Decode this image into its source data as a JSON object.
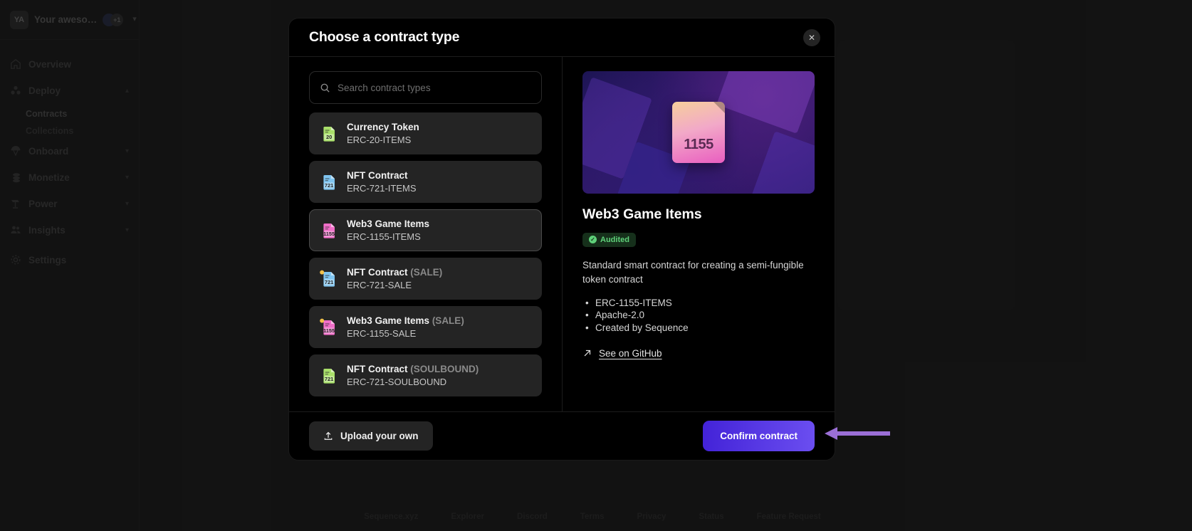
{
  "sidebar": {
    "org": {
      "avatar_initials": "YA",
      "name": "Your aweso…",
      "extra_count": "+1",
      "chevron": "chevron-down"
    },
    "items": [
      {
        "label": "Overview",
        "icon": "home-icon",
        "has_caret": false
      },
      {
        "label": "Deploy",
        "icon": "deploy-icon",
        "has_caret": true,
        "caret": "chevron-up"
      },
      {
        "label": "Onboard",
        "icon": "parachute-icon",
        "has_caret": true,
        "caret": "chevron-down"
      },
      {
        "label": "Monetize",
        "icon": "coins-icon",
        "has_caret": true,
        "caret": "chevron-down"
      },
      {
        "label": "Power",
        "icon": "power-icon",
        "has_caret": true,
        "caret": "chevron-down"
      },
      {
        "label": "Insights",
        "icon": "people-icon",
        "has_caret": true,
        "caret": "chevron-down"
      },
      {
        "label": "Settings",
        "icon": "gear-icon",
        "has_caret": false
      }
    ],
    "deploy_subitems": [
      {
        "label": "Contracts",
        "active": true
      },
      {
        "label": "Collections",
        "active": false
      }
    ]
  },
  "page_footer": {
    "links": [
      "Sequence.xyz",
      "Explorer",
      "Discord",
      "Terms",
      "Privacy",
      "Status",
      "Feature Request"
    ]
  },
  "modal": {
    "title": "Choose a contract type",
    "close_label": "✕",
    "search": {
      "placeholder": "Search contract types",
      "value": ""
    },
    "contract_types": [
      {
        "name": "Currency Token",
        "variant": "",
        "code": "ERC-20-ITEMS",
        "icon": "erc20-file-icon",
        "badge": "20",
        "color": "#a9e06a",
        "selected": false,
        "sale": false
      },
      {
        "name": "NFT Contract",
        "variant": "",
        "code": "ERC-721-ITEMS",
        "icon": "erc721-file-icon",
        "badge": "721",
        "color": "#7fc4ef",
        "selected": false,
        "sale": false
      },
      {
        "name": "Web3 Game Items",
        "variant": "",
        "code": "ERC-1155-ITEMS",
        "icon": "erc1155-file-icon",
        "badge": "1155",
        "color": "#f06ec8",
        "selected": true,
        "sale": false
      },
      {
        "name": "NFT Contract",
        "variant": "(SALE)",
        "code": "ERC-721-SALE",
        "icon": "erc721-sale-file-icon",
        "badge": "721",
        "color": "#7fc4ef",
        "selected": false,
        "sale": true
      },
      {
        "name": "Web3 Game Items",
        "variant": "(SALE)",
        "code": "ERC-1155-SALE",
        "icon": "erc1155-sale-file-icon",
        "badge": "1155",
        "color": "#f06ec8",
        "selected": false,
        "sale": true
      },
      {
        "name": "NFT Contract",
        "variant": "(SOULBOUND)",
        "code": "ERC-721-SOULBOUND",
        "icon": "erc721-soulbound-file-icon",
        "badge": "721",
        "color": "#a9e06a",
        "selected": false,
        "sale": false
      }
    ],
    "detail": {
      "hero_label": "1155",
      "title": "Web3 Game Items",
      "badge": "Audited",
      "description": "Standard smart contract for creating a semi-fungible token contract",
      "facts": [
        "ERC-1155-ITEMS",
        "Apache-2.0",
        "Created by Sequence"
      ],
      "github_link": "See on GitHub",
      "github_icon": "arrow-up-right-icon"
    },
    "footer": {
      "upload_label": "Upload your own",
      "upload_icon": "upload-icon",
      "confirm_label": "Confirm contract"
    }
  },
  "annotation": {
    "type": "arrow-left",
    "color": "#9b6fd6"
  }
}
